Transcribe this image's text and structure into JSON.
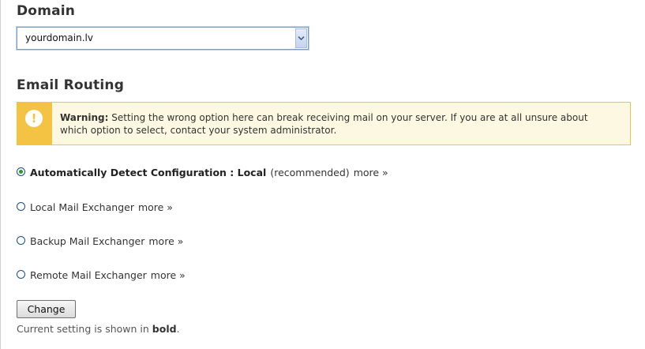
{
  "domain": {
    "heading": "Domain",
    "selected": "yourdomain.lv",
    "arrow_icon": "chevron-down-icon"
  },
  "routing": {
    "heading": "Email Routing",
    "warning": {
      "icon": "exclamation-icon",
      "label": "Warning:",
      "message": "Setting the wrong option here can break receiving mail on your server. If you are at all unsure about which option to select, contact your system administrator."
    },
    "options": [
      {
        "label": "Automatically Detect Configuration : Local",
        "suffix": "(recommended)",
        "more": "more »",
        "checked": true
      },
      {
        "label": "Local Mail Exchanger",
        "more": "more »",
        "checked": false
      },
      {
        "label": "Backup Mail Exchanger",
        "more": "more »",
        "checked": false
      },
      {
        "label": "Remote Mail Exchanger",
        "more": "more »",
        "checked": false
      }
    ],
    "button_label": "Change",
    "hint_prefix": "Current setting is shown in",
    "hint_bold": "bold",
    "hint_suffix": "."
  },
  "colors": {
    "warning_accent": "#f5c344",
    "warning_bg": "#fcf8e1",
    "radio_checked": "#2a9a2a"
  }
}
